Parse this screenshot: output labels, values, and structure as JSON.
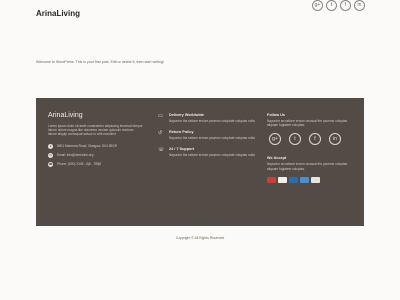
{
  "header": {
    "brand": "ArinaLiving"
  },
  "social_icons": [
    "google-plus-icon",
    "twitter-icon",
    "facebook-icon",
    "linkedin-icon"
  ],
  "main": {
    "welcome_text": "Welcome to WordPress. This is your first post. Edit or delete it, then start writing!"
  },
  "footer": {
    "about": {
      "title": "ArinaLiving",
      "description": "Lorem ipsum dolor sit amet consectetur adipiscing eiusmod tempor labore dolore magna like doloremo veniam quisnulo nostrum labore aliquip consequat salvus in velit excullent",
      "address": "8901 Marmora Road, Glasgow, D04 89GR",
      "email": "Email: info@demolink.org",
      "phone": "Phone: (800) 2345 - 6j8 - 789j0"
    },
    "services": [
      {
        "title": "Delivery Worldwide",
        "text": "Nayuntur tha ratione ercium psuemo voluptate voluptas nulla"
      },
      {
        "title": "Return Policy",
        "text": "Nayuntur tha ratione ercium psuemo voluptate voluptas nulla"
      },
      {
        "title": "24 / 7 Support",
        "text": "Nayuntur tha ratione ercium psuemo voluptate voluptas nulla"
      }
    ],
    "follow_us": {
      "title": "Follow Us",
      "text": "Nayuntur an ratione ercum unusual the psuemo voluptas aliquam fugiatem voluptas."
    },
    "we_accept": {
      "title": "We Accept",
      "text": "Nayuntur an ratione ercum unusual the psuemo voluptas aliquam fugiatem voluptas."
    },
    "payment_colors": [
      "#c63f3a",
      "#f2efe9",
      "#2b6cb0",
      "#4c8fd0",
      "#e7e3dd"
    ]
  },
  "copyright": "Copyright © All Rights Reserved"
}
